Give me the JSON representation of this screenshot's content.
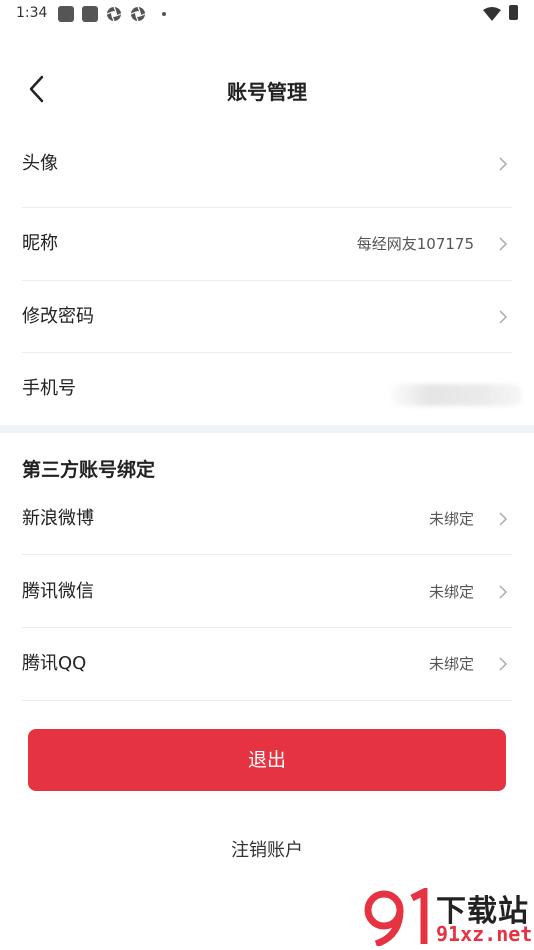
{
  "status_bar": {
    "time": "1:34"
  },
  "header": {
    "title": "账号管理"
  },
  "account_rows": [
    {
      "label": "头像",
      "value": ""
    },
    {
      "label": "昵称",
      "value": "每经网友107175"
    },
    {
      "label": "修改密码",
      "value": ""
    },
    {
      "label": "手机号",
      "value": ""
    }
  ],
  "third_party": {
    "title": "第三方账号绑定",
    "rows": [
      {
        "label": "新浪微博",
        "value": "未绑定"
      },
      {
        "label": "腾讯微信",
        "value": "未绑定"
      },
      {
        "label": "腾讯QQ",
        "value": "未绑定"
      }
    ]
  },
  "actions": {
    "logout": "退出",
    "cancel_account": "注销账户"
  },
  "watermark": {
    "text": "下载站",
    "url": "91xz.net",
    "logo_glyph": "9"
  },
  "colors": {
    "accent": "#e63341",
    "section_gap": "#eef3f8",
    "divider": "#ececec"
  }
}
